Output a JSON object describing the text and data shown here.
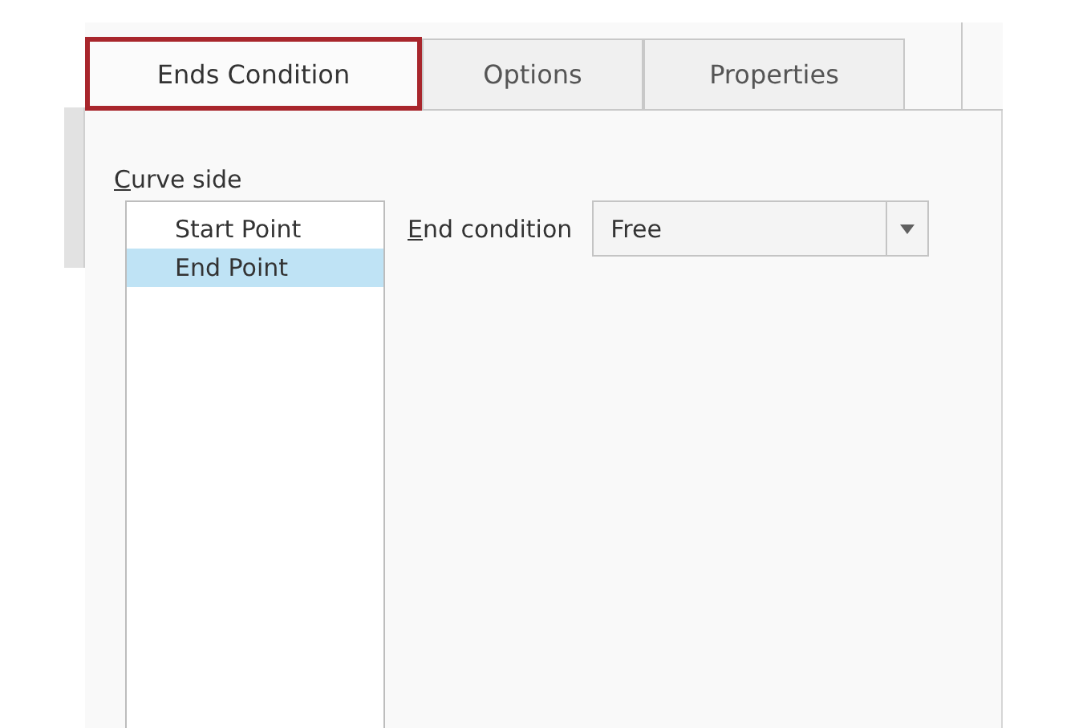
{
  "tabs": [
    {
      "label": "Ends Condition",
      "selected": true,
      "highlighted": true
    },
    {
      "label": "Options",
      "selected": false,
      "highlighted": false
    },
    {
      "label": "Properties",
      "selected": false,
      "highlighted": false
    }
  ],
  "curve_side": {
    "label": "Curve side",
    "items": [
      {
        "label": "Start Point",
        "selected": false
      },
      {
        "label": "End Point",
        "selected": true
      }
    ]
  },
  "end_condition": {
    "label": "End condition",
    "value": "Free"
  }
}
